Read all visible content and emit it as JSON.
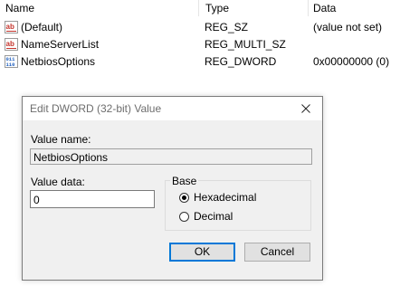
{
  "list": {
    "columns": [
      "Name",
      "Type",
      "Data"
    ],
    "rows": [
      {
        "icon": "string-value-icon",
        "name": "(Default)",
        "type": "REG_SZ",
        "data": "(value not set)"
      },
      {
        "icon": "string-value-icon",
        "name": "NameServerList",
        "type": "REG_MULTI_SZ",
        "data": ""
      },
      {
        "icon": "binary-value-icon",
        "name": "NetbiosOptions",
        "type": "REG_DWORD",
        "data": "0x00000000 (0)"
      }
    ]
  },
  "dialog": {
    "title": "Edit DWORD (32-bit) Value",
    "value_name_label": "Value name:",
    "value_name": "NetbiosOptions",
    "value_data_label": "Value data:",
    "value_data": "0",
    "base_label": "Base",
    "base_options": [
      {
        "label": "Hexadecimal",
        "checked": true
      },
      {
        "label": "Decimal",
        "checked": false
      }
    ],
    "ok_label": "OK",
    "cancel_label": "Cancel"
  },
  "colors": {
    "accent": "#0078d7",
    "string_icon": "#c4332b",
    "binary_icon": "#1f5fbf"
  }
}
